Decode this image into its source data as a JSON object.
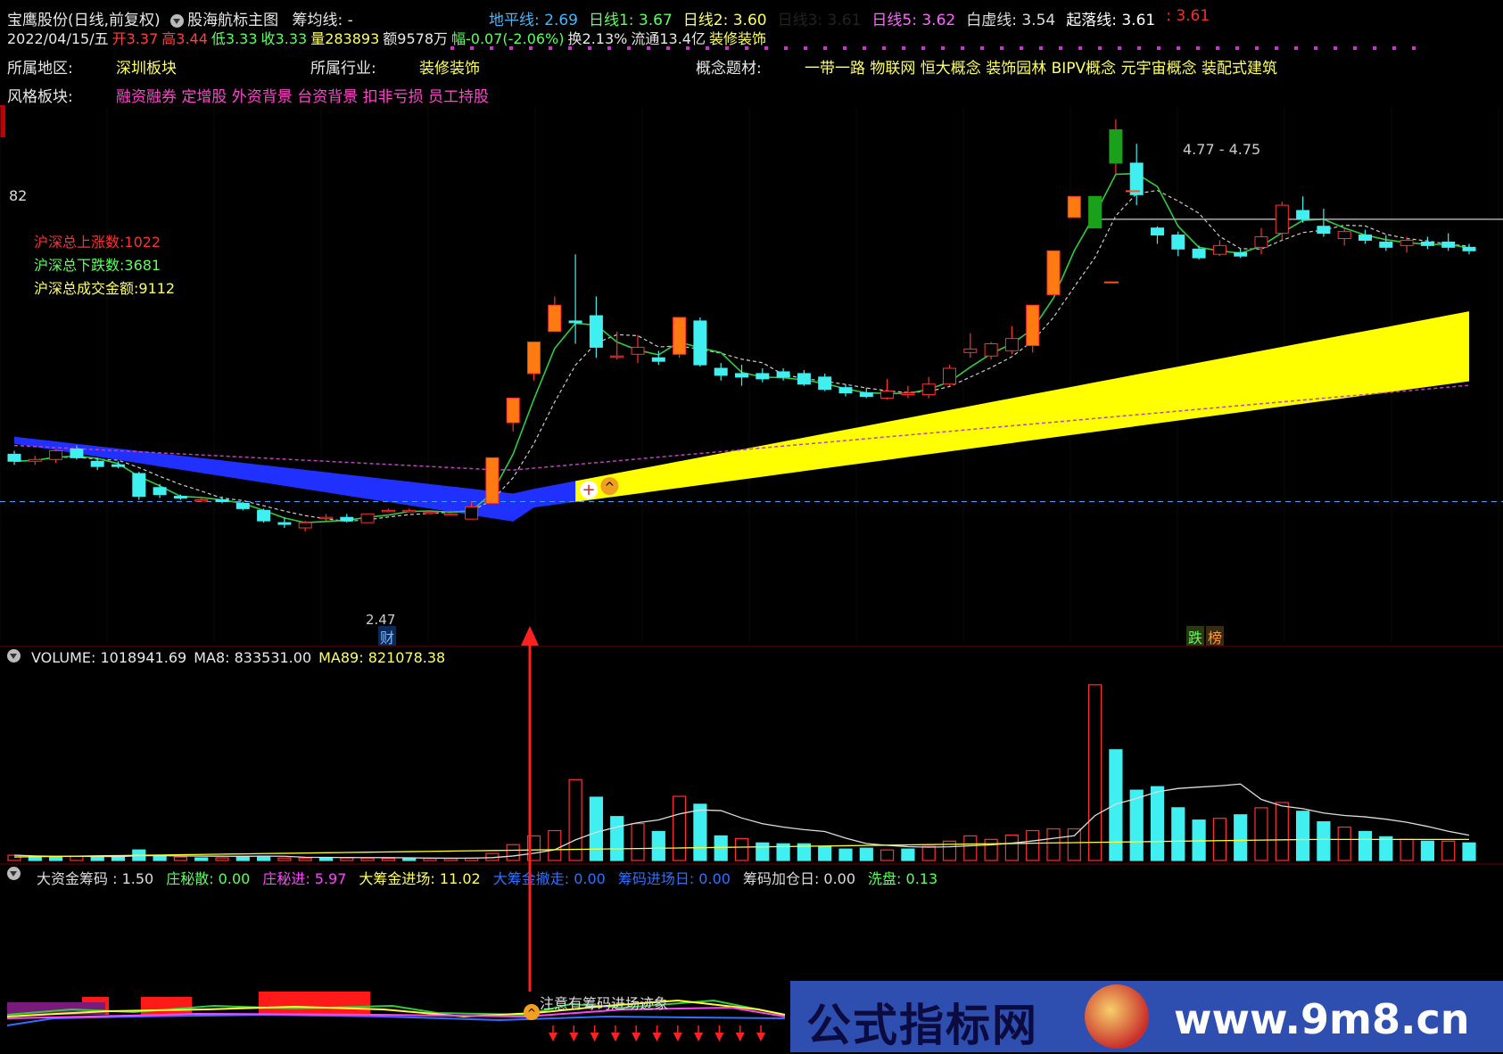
{
  "header": {
    "stock_name": "宝鹰股份",
    "period_mode": "(日线,前复权)",
    "indicator_name": "股海航标主图",
    "chip_line": "筹均线: -",
    "lines": [
      {
        "label": "地平线: 2.69",
        "color": "#3fb8ff"
      },
      {
        "label": "日线1: 3.67",
        "color": "#5cff5c"
      },
      {
        "label": "日线2: 3.60",
        "color": "#ffff66"
      },
      {
        "label": "日线3: 3.61",
        "color": "#222222"
      },
      {
        "label": "日线5: 3.62",
        "color": "#ff66ff"
      },
      {
        "label": "白虚线: 3.54",
        "color": "#dddddd"
      },
      {
        "label": "起落线: 3.61",
        "color": "#ffffff"
      },
      {
        "label": ": 3.61",
        "color": "#ff2a2a"
      }
    ]
  },
  "quote": {
    "date": "2022/04/15/五",
    "open": "开3.37",
    "high": "高3.44",
    "low": "低3.33",
    "close": "收3.33",
    "volume": "量283893",
    "amount": "额9578万",
    "change": "幅-0.07(-2.06%)",
    "turnover": "换2.13%",
    "float_cap": "流通13.4亿",
    "sector_tag": "装修装饰"
  },
  "info": {
    "region_label": "所属地区:",
    "region_value": "深圳板块",
    "industry_label": "所属行业:",
    "industry_value": "装修装饰",
    "concept_label": "概念题材:",
    "concept_value": "一带一路 物联网 恒大概念 装饰园林 BIPV概念 元宇宙概念 装配式建筑",
    "style_label": "风格板块:",
    "style_value": "融资融券 定增股 外资背景 台资背景 扣非亏损 员工持股"
  },
  "market": {
    "axis_value": "82",
    "up_count": "沪深总上涨数:1022",
    "down_count": "沪深总下跌数:3681",
    "turnover_total": "沪深总成交金额:9112"
  },
  "annotations": {
    "peak_range": "4.77 - 4.75",
    "low_price": "2.47",
    "cai_badge": "财",
    "die_badge": "跌",
    "bang_badge": "榜",
    "chip_warning": "注意有筹码进场迹象"
  },
  "volume_header": {
    "volume": "VOLUME: 1018941.69",
    "ma8": "MA8: 833531.00",
    "ma89": "MA89: 821078.38"
  },
  "indicator_header": {
    "items": [
      {
        "label": "大资金筹码 : 1.50",
        "color": "#dddddd"
      },
      {
        "label": "庄秘散: 0.00",
        "color": "#5cff5c"
      },
      {
        "label": "庄秘进: 5.97",
        "color": "#ff44ff"
      },
      {
        "label": "大筹金进场: 11.02",
        "color": "#ffff66"
      },
      {
        "label": "大筹金撤走: 0.00",
        "color": "#3070ff"
      },
      {
        "label": "筹码进场日: 0.00",
        "color": "#3070ff"
      },
      {
        "label": "筹码加仓日: 0.00",
        "color": "#dddddd"
      },
      {
        "label": "洗盘: 0.13",
        "color": "#5cff5c"
      }
    ]
  },
  "watermark": {
    "site_name": "公式指标网",
    "url": "www.9m8.cn"
  },
  "chart_data": {
    "type": "candlestick",
    "price_axis_marks": [
      82
    ],
    "candles": [
      {
        "o": 3.42,
        "h": 3.44,
        "l": 3.36,
        "c": 3.38
      },
      {
        "o": 3.38,
        "h": 3.41,
        "l": 3.36,
        "c": 3.39
      },
      {
        "o": 3.39,
        "h": 3.45,
        "l": 3.37,
        "c": 3.44
      },
      {
        "o": 3.45,
        "h": 3.47,
        "l": 3.39,
        "c": 3.4
      },
      {
        "o": 3.38,
        "h": 3.4,
        "l": 3.33,
        "c": 3.35
      },
      {
        "o": 3.36,
        "h": 3.38,
        "l": 3.34,
        "c": 3.35
      },
      {
        "o": 3.31,
        "h": 3.32,
        "l": 3.16,
        "c": 3.18
      },
      {
        "o": 3.23,
        "h": 3.25,
        "l": 3.17,
        "c": 3.19
      },
      {
        "o": 3.18,
        "h": 3.19,
        "l": 3.16,
        "c": 3.17
      },
      {
        "o": 3.16,
        "h": 3.18,
        "l": 3.15,
        "c": 3.16
      },
      {
        "o": 3.16,
        "h": 3.18,
        "l": 3.14,
        "c": 3.15
      },
      {
        "o": 3.14,
        "h": 3.15,
        "l": 3.1,
        "c": 3.11
      },
      {
        "o": 3.1,
        "h": 3.11,
        "l": 3.03,
        "c": 3.04
      },
      {
        "o": 3.03,
        "h": 3.06,
        "l": 3.0,
        "c": 3.02
      },
      {
        "o": 3.0,
        "h": 3.04,
        "l": 2.98,
        "c": 3.03
      },
      {
        "o": 3.06,
        "h": 3.08,
        "l": 3.04,
        "c": 3.06
      },
      {
        "o": 3.06,
        "h": 3.08,
        "l": 3.03,
        "c": 3.04
      },
      {
        "o": 3.03,
        "h": 3.08,
        "l": 3.03,
        "c": 3.08
      },
      {
        "o": 3.1,
        "h": 3.11,
        "l": 3.09,
        "c": 3.1
      },
      {
        "o": 3.1,
        "h": 3.11,
        "l": 3.09,
        "c": 3.1
      },
      {
        "o": 3.09,
        "h": 3.1,
        "l": 3.08,
        "c": 3.09
      },
      {
        "o": 3.08,
        "h": 3.1,
        "l": 3.07,
        "c": 3.08
      },
      {
        "o": 3.05,
        "h": 3.15,
        "l": 3.05,
        "c": 3.12
      },
      {
        "o": 3.14,
        "h": 3.4,
        "l": 3.14,
        "c": 3.4
      },
      {
        "o": 3.6,
        "h": 3.74,
        "l": 3.55,
        "c": 3.74
      },
      {
        "o": 3.88,
        "h": 4.06,
        "l": 3.84,
        "c": 4.06
      },
      {
        "o": 4.12,
        "h": 4.32,
        "l": 4.12,
        "c": 4.27
      },
      {
        "o": 4.18,
        "h": 4.56,
        "l": 4.05,
        "c": 4.17
      },
      {
        "o": 4.21,
        "h": 4.32,
        "l": 3.97,
        "c": 4.03
      },
      {
        "o": 3.98,
        "h": 4.12,
        "l": 3.96,
        "c": 3.98
      },
      {
        "o": 3.99,
        "h": 4.1,
        "l": 3.94,
        "c": 4.03
      },
      {
        "o": 3.97,
        "h": 4.01,
        "l": 3.93,
        "c": 3.95
      },
      {
        "o": 3.99,
        "h": 4.2,
        "l": 3.97,
        "c": 4.2
      },
      {
        "o": 4.18,
        "h": 4.2,
        "l": 3.92,
        "c": 3.93
      },
      {
        "o": 3.91,
        "h": 3.94,
        "l": 3.84,
        "c": 3.87
      },
      {
        "o": 3.88,
        "h": 3.93,
        "l": 3.81,
        "c": 3.86
      },
      {
        "o": 3.88,
        "h": 3.91,
        "l": 3.83,
        "c": 3.85
      },
      {
        "o": 3.89,
        "h": 3.91,
        "l": 3.84,
        "c": 3.86
      },
      {
        "o": 3.88,
        "h": 3.9,
        "l": 3.81,
        "c": 3.82
      },
      {
        "o": 3.86,
        "h": 3.88,
        "l": 3.78,
        "c": 3.79
      },
      {
        "o": 3.8,
        "h": 3.82,
        "l": 3.75,
        "c": 3.77
      },
      {
        "o": 3.77,
        "h": 3.8,
        "l": 3.74,
        "c": 3.75
      },
      {
        "o": 3.74,
        "h": 3.85,
        "l": 3.73,
        "c": 3.78
      },
      {
        "o": 3.76,
        "h": 3.81,
        "l": 3.74,
        "c": 3.77
      },
      {
        "o": 3.76,
        "h": 3.86,
        "l": 3.74,
        "c": 3.82
      },
      {
        "o": 3.82,
        "h": 3.93,
        "l": 3.81,
        "c": 3.91
      },
      {
        "o": 4.0,
        "h": 4.11,
        "l": 3.97,
        "c": 4.02
      },
      {
        "o": 3.98,
        "h": 4.06,
        "l": 3.96,
        "c": 4.05
      },
      {
        "o": 4.01,
        "h": 4.15,
        "l": 3.99,
        "c": 4.08
      },
      {
        "o": 4.04,
        "h": 4.27,
        "l": 4.0,
        "c": 4.27
      },
      {
        "o": 4.33,
        "h": 4.58,
        "l": 4.33,
        "c": 4.58
      },
      {
        "o": 4.77,
        "h": 4.89,
        "l": 4.77,
        "c": 4.89
      },
      {
        "o": 4.71,
        "h": 4.89,
        "l": 4.71,
        "c": 4.89
      },
      {
        "o": 5.08,
        "h": 5.33,
        "l": 5.02,
        "c": 5.27
      },
      {
        "o": 5.08,
        "h": 5.19,
        "l": 4.84,
        "c": 4.9
      },
      {
        "o": 4.71,
        "h": 4.72,
        "l": 4.62,
        "c": 4.67
      },
      {
        "o": 4.67,
        "h": 4.69,
        "l": 4.55,
        "c": 4.59
      },
      {
        "o": 4.59,
        "h": 4.61,
        "l": 4.53,
        "c": 4.54
      },
      {
        "o": 4.56,
        "h": 4.64,
        "l": 4.55,
        "c": 4.61
      },
      {
        "o": 4.57,
        "h": 4.59,
        "l": 4.54,
        "c": 4.55
      },
      {
        "o": 4.6,
        "h": 4.71,
        "l": 4.56,
        "c": 4.66
      },
      {
        "o": 4.68,
        "h": 4.86,
        "l": 4.64,
        "c": 4.84
      },
      {
        "o": 4.81,
        "h": 4.89,
        "l": 4.74,
        "c": 4.76
      },
      {
        "o": 4.72,
        "h": 4.82,
        "l": 4.66,
        "c": 4.68
      },
      {
        "o": 4.65,
        "h": 4.71,
        "l": 4.61,
        "c": 4.69
      },
      {
        "o": 4.67,
        "h": 4.7,
        "l": 4.62,
        "c": 4.64
      },
      {
        "o": 4.63,
        "h": 4.67,
        "l": 4.58,
        "c": 4.6
      },
      {
        "o": 4.61,
        "h": 4.66,
        "l": 4.57,
        "c": 4.64
      },
      {
        "o": 4.63,
        "h": 4.66,
        "l": 4.59,
        "c": 4.61
      },
      {
        "o": 4.63,
        "h": 4.68,
        "l": 4.58,
        "c": 4.6
      },
      {
        "o": 4.6,
        "h": 4.62,
        "l": 4.56,
        "c": 4.58
      }
    ],
    "volumes": [
      30,
      22,
      20,
      24,
      18,
      18,
      60,
      25,
      20,
      15,
      15,
      20,
      25,
      14,
      14,
      16,
      15,
      14,
      12,
      12,
      12,
      11,
      14,
      40,
      90,
      140,
      170,
      460,
      360,
      250,
      210,
      165,
      365,
      320,
      140,
      125,
      100,
      95,
      95,
      80,
      65,
      70,
      60,
      65,
      80,
      110,
      140,
      120,
      145,
      170,
      180,
      180,
      1000,
      630,
      400,
      420,
      300,
      230,
      240,
      260,
      300,
      330,
      280,
      220,
      190,
      165,
      135,
      120,
      110,
      110,
      100
    ],
    "volume_is_up": [
      true,
      false,
      false,
      true,
      false,
      false,
      false,
      false,
      true,
      false,
      true,
      false,
      false,
      true,
      true,
      false,
      true,
      true,
      true,
      false,
      true,
      true,
      true,
      true,
      true,
      true,
      true,
      true,
      false,
      false,
      true,
      false,
      true,
      false,
      false,
      true,
      false,
      false,
      false,
      false,
      false,
      false,
      true,
      false,
      true,
      true,
      true,
      true,
      true,
      true,
      true,
      true,
      true,
      false,
      false,
      false,
      false,
      false,
      true,
      false,
      true,
      true,
      false,
      false,
      true,
      false,
      false,
      true,
      false,
      true,
      false
    ]
  }
}
